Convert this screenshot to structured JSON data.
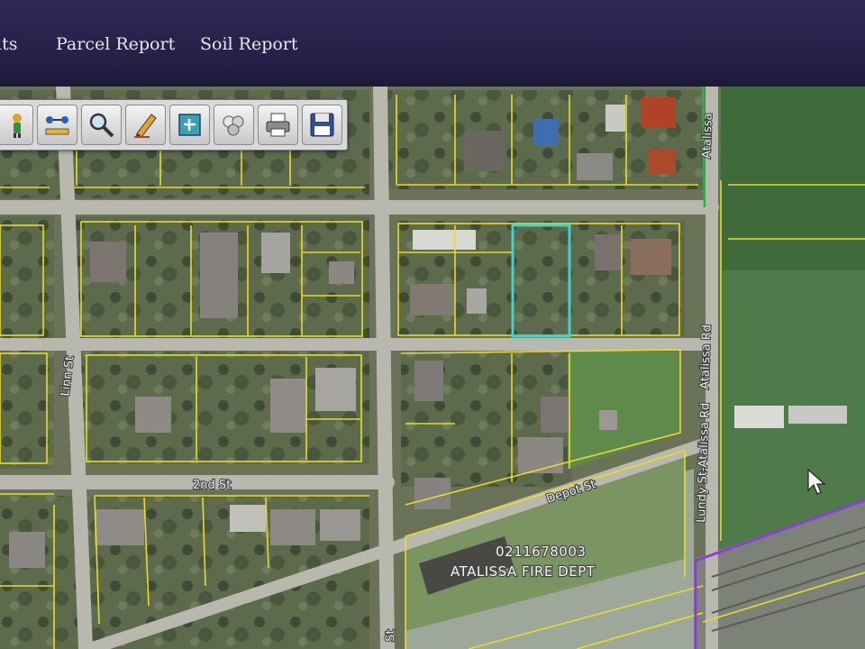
{
  "nav": {
    "results_tab_partial": "lts",
    "parcel_report": "Parcel Report",
    "soil_report": "Soil Report"
  },
  "toolbar": {
    "tools": [
      "identify-person-icon",
      "network-tool-icon",
      "zoom-icon",
      "draw-pencil-icon",
      "full-extent-icon",
      "layers-icon",
      "print-icon",
      "save-icon"
    ]
  },
  "map": {
    "street_labels": {
      "linn_st": "Linn St",
      "second_st": "2nd St",
      "depot_st": "Depot St",
      "atalissa_rd_right": "Atalissa Rd",
      "atalissa_rd_top": "Atalissa",
      "lundy_st_atalissa_rd": "Lundy St-Atalissa Rd",
      "bottom_street": "St"
    },
    "parcel_id": "0211678003",
    "parcel_name": "ATALISSA FIRE DEPT",
    "colors": {
      "parcel_lines": "#e8dc2a",
      "selected_parcel": "#3cd3d0",
      "boundary": "#8b3fd6",
      "green_line": "#28b44a"
    }
  }
}
